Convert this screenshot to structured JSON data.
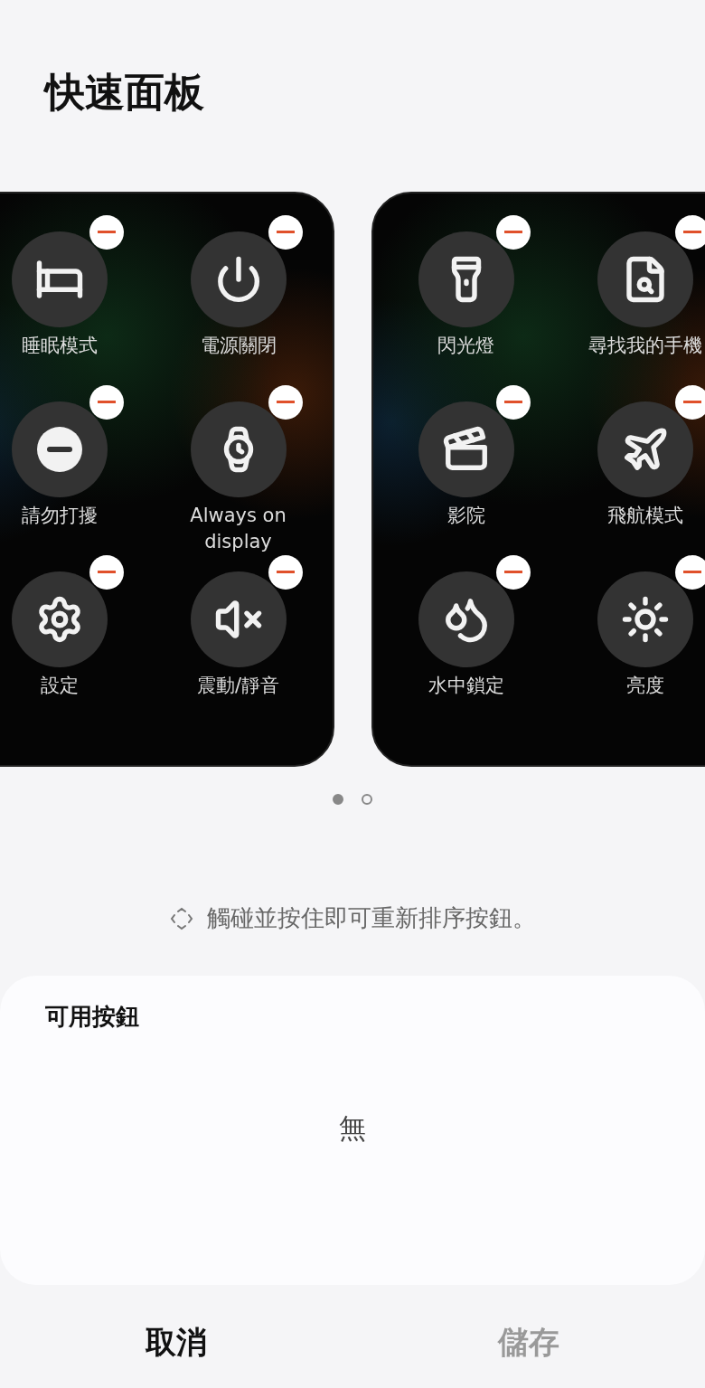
{
  "title": "快速面板",
  "pages": [
    {
      "buttons": [
        {
          "label": "睡眠模式"
        },
        {
          "label": "電源關閉"
        },
        {
          "label": "請勿打擾"
        },
        {
          "label": "Always on display"
        },
        {
          "label": "設定"
        },
        {
          "label": "震動/靜音"
        }
      ]
    },
    {
      "buttons": [
        {
          "label": "閃光燈"
        },
        {
          "label": "尋找我的手機"
        },
        {
          "label": "影院"
        },
        {
          "label": "飛航模式"
        },
        {
          "label": "水中鎖定"
        },
        {
          "label": "亮度"
        }
      ]
    }
  ],
  "page_dots": [
    {
      "selected": true
    },
    {
      "selected": false
    }
  ],
  "hint": "觸碰並按住即可重新排序按鈕。",
  "available": {
    "title": "可用按鈕",
    "empty_text": "無"
  },
  "actions": [
    {
      "label": "取消",
      "disabled": false
    },
    {
      "label": "儲存",
      "disabled": true
    }
  ]
}
